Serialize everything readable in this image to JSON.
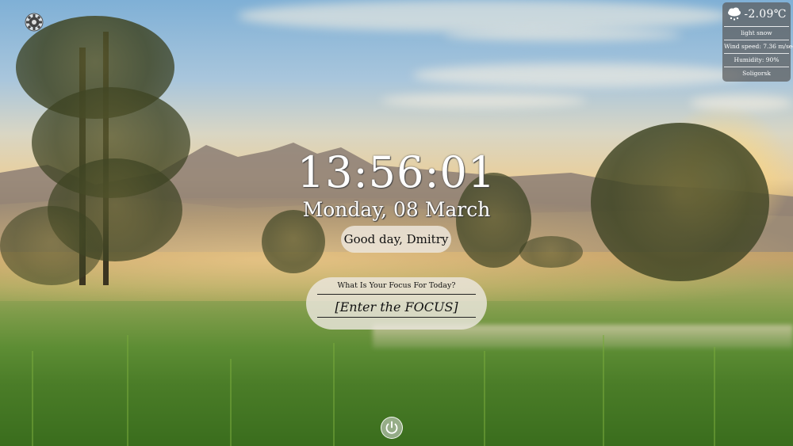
{
  "background": {
    "description_colors": {
      "sky": "#8fb6d6",
      "glow": "#f3d28a",
      "grass": "#4b7d28"
    }
  },
  "settings": {
    "icon": "gear-icon"
  },
  "weather": {
    "icon": "snow-cloud-icon",
    "temperature": "-2.09℃",
    "condition": "light snow",
    "wind": "Wind speed: 7.36 m/sec",
    "humidity": "Humidity: 90%",
    "city": "Soligorsk"
  },
  "clock": {
    "time": "13:56:01",
    "date": "Monday, 08 March"
  },
  "greeting": {
    "text": "Good day, Dmitry"
  },
  "focus": {
    "question": "What Is Your Focus For Today?",
    "placeholder": "[Enter the FOCUS]"
  },
  "power": {
    "icon": "power-icon"
  }
}
